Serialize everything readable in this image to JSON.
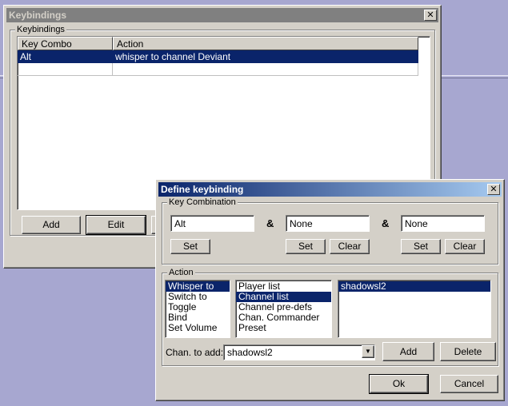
{
  "main_window": {
    "title": "Keybindings",
    "group_label": "Keybindings",
    "columns": [
      "Key Combo",
      "Action"
    ],
    "rows": [
      {
        "key": "Alt",
        "action": "whisper to channel Deviant",
        "selected": true
      },
      {
        "key": "",
        "action": "",
        "selected": false
      }
    ],
    "buttons": {
      "add": "Add",
      "edit": "Edit"
    }
  },
  "dialog": {
    "title": "Define keybinding",
    "key_group_label": "Key Combination",
    "key1": "Alt",
    "key2": "None",
    "key3": "None",
    "amp": "&",
    "set_label": "Set",
    "clear_label": "Clear",
    "action_group_label": "Action",
    "action_types": [
      "Whisper to",
      "Switch to",
      "Toggle",
      "Bind",
      "Set Volume"
    ],
    "targets": [
      "Player list",
      "Channel list",
      "Channel pre-defs",
      "Chan. Commander",
      "Preset"
    ],
    "selected_channels": [
      "shadowsl2"
    ],
    "chan_label": "Chan. to add:",
    "chan_value": "shadowsl2",
    "add_label": "Add",
    "delete_label": "Delete",
    "ok_label": "Ok",
    "cancel_label": "Cancel"
  },
  "colors": {
    "selection": "#0a246a",
    "window_face": "#d4d0c8",
    "desktop": "#a7a7d0"
  }
}
